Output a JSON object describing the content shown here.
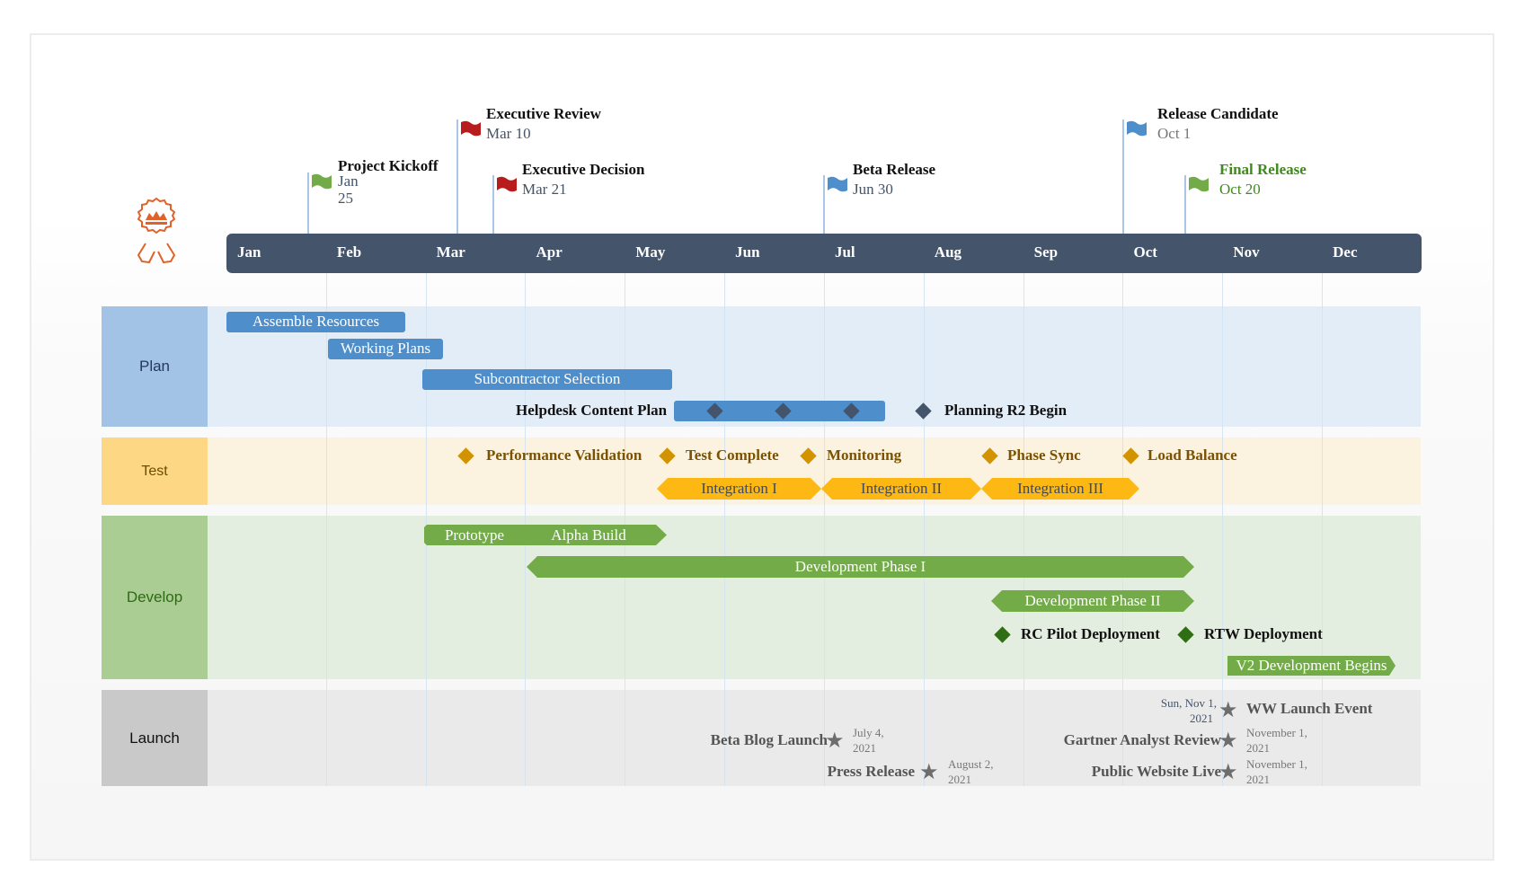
{
  "badge": {
    "icon": "award-crown-icon",
    "color": "#e0622a"
  },
  "timescale": {
    "months": [
      "Jan",
      "Feb",
      "Mar",
      "Apr",
      "May",
      "Jun",
      "Jul",
      "Aug",
      "Sep",
      "Oct",
      "Nov",
      "Dec"
    ]
  },
  "milestones": [
    {
      "title": "Project Kickoff",
      "date_line1": "Jan",
      "date_line2": "25",
      "flag_color": "#72ab47",
      "icon": "flag-icon"
    },
    {
      "title": "Executive Review",
      "date": "Mar 10",
      "flag_color": "#b91c1c",
      "icon": "flag-icon"
    },
    {
      "title": "Executive Decision",
      "date": "Mar 21",
      "flag_color": "#b91c1c",
      "icon": "flag-icon"
    },
    {
      "title": "Beta Release",
      "date": "Jun 30",
      "flag_color": "#4e8ecb",
      "icon": "flag-icon"
    },
    {
      "title": "Release Candidate",
      "date": "Oct 1",
      "flag_color": "#4e8ecb",
      "icon": "flag-icon"
    },
    {
      "title": "Final Release",
      "date": "Oct 20",
      "flag_color": "#72ab47",
      "text_color": "#3f8a1c",
      "icon": "flag-icon"
    }
  ],
  "lanes": {
    "plan": {
      "label": "Plan",
      "tasks": [
        "Assemble Resources",
        "Working Plans",
        "Subcontractor Selection"
      ],
      "helpdesk_label": "Helpdesk Content Plan",
      "planning_r2": "Planning R2 Begin"
    },
    "test": {
      "label": "Test",
      "milestones": [
        "Performance Validation",
        "Test Complete",
        "Monitoring",
        "Phase Sync",
        "Load Balance"
      ],
      "integrations": [
        "Integration I",
        "Integration II",
        "Integration III"
      ]
    },
    "develop": {
      "label": "Develop",
      "prototype": "Prototype",
      "alpha": "Alpha Build",
      "phase1": "Development Phase I",
      "phase2": "Development Phase II",
      "rc_pilot": "RC Pilot Deployment",
      "rtw": "RTW Deployment",
      "v2": "V2 Development Begins"
    },
    "launch": {
      "label": "Launch",
      "events": [
        {
          "title": "Beta Blog Launch",
          "date_line1": "July 4,",
          "date_line2": "2021"
        },
        {
          "title": "Press Release",
          "date_line1": "August 2,",
          "date_line2": "2021"
        },
        {
          "title": "WW Launch Event",
          "date_line1": "Sun, Nov 1,",
          "date_line2": "2021"
        },
        {
          "title": "Gartner Analyst Review",
          "date_line1": "November 1,",
          "date_line2": "2021"
        },
        {
          "title": "Public Website Live",
          "date_line1": "November 1,",
          "date_line2": "2021"
        }
      ]
    }
  },
  "colors": {
    "timebar": "#44546a",
    "plan": "#4e8ecb",
    "test": "#fdb813",
    "test_diamond": "#d39300",
    "develop": "#72ab47",
    "develop_diamond": "#2f6e14",
    "launch_star": "#6d6d6d"
  }
}
